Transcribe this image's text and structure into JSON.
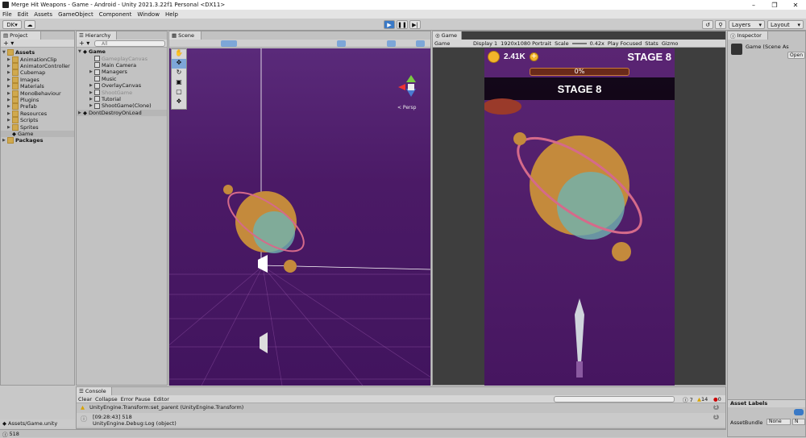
{
  "window": {
    "title": "Merge Hit Weapons - Game - Android - Unity 2021.3.22f1 Personal <DX11>"
  },
  "menu": [
    "File",
    "Edit",
    "Assets",
    "GameObject",
    "Component",
    "Window",
    "Help"
  ],
  "toolbar": {
    "account": "DK",
    "layers": "Layers",
    "layout": "Layout"
  },
  "project": {
    "tab": "Project",
    "root": "Assets",
    "folders": [
      "AnimationClip",
      "AnimatorController",
      "Cubemap",
      "Images",
      "Materials",
      "MonoBehaviour",
      "Plugins",
      "Prefab",
      "Resources",
      "Scripts",
      "Sprites",
      "Game"
    ],
    "packages": "Packages"
  },
  "hierarchy": {
    "tab": "Hierarchy",
    "search_placeholder": "All",
    "scene": "Game",
    "items": [
      "GameplayCanvas",
      "Main Camera",
      "Managers",
      "Music",
      "OverlayCanvas",
      "ShootGame",
      "Tutorial",
      "ShootGame(Clone)"
    ],
    "ddol": "DontDestroyOnLoad"
  },
  "scene": {
    "tab": "Scene",
    "persp": "< Persp"
  },
  "game": {
    "tab": "Game",
    "mode": "Game",
    "display": "Display 1",
    "resolution": "1920x1080 Portrait",
    "scale_label": "Scale",
    "scale_value": "0.42x",
    "play_focused": "Play Focused",
    "stats": "Stats",
    "gizmos": "Gizmo",
    "coins": "2.41K",
    "stage_top": "STAGE 8",
    "progress": "0%",
    "stage_banner": "STAGE 8"
  },
  "inspector": {
    "tab": "Inspector",
    "object": "Game (Scene As",
    "open": "Open",
    "asset_labels": "Asset Labels",
    "asset_bundle": "AssetBundle",
    "none": "None",
    "none2": "N"
  },
  "console": {
    "tab": "Console",
    "clear": "Clear",
    "collapse": "Collapse",
    "error_pause": "Error Pause",
    "editor": "Editor",
    "count_info": "7",
    "count_warn": "14",
    "count_err": "0",
    "log1_line2": "UnityEngine.Transform:set_parent (UnityEngine.Transform)",
    "log2_line1": "[09:28:43] 518",
    "log2_line2": "UnityEngine.Debug:Log (object)",
    "log_badge1": "1",
    "log_badge2": "1"
  },
  "status": {
    "path": "Assets/Game.unity",
    "bottom": "518"
  }
}
